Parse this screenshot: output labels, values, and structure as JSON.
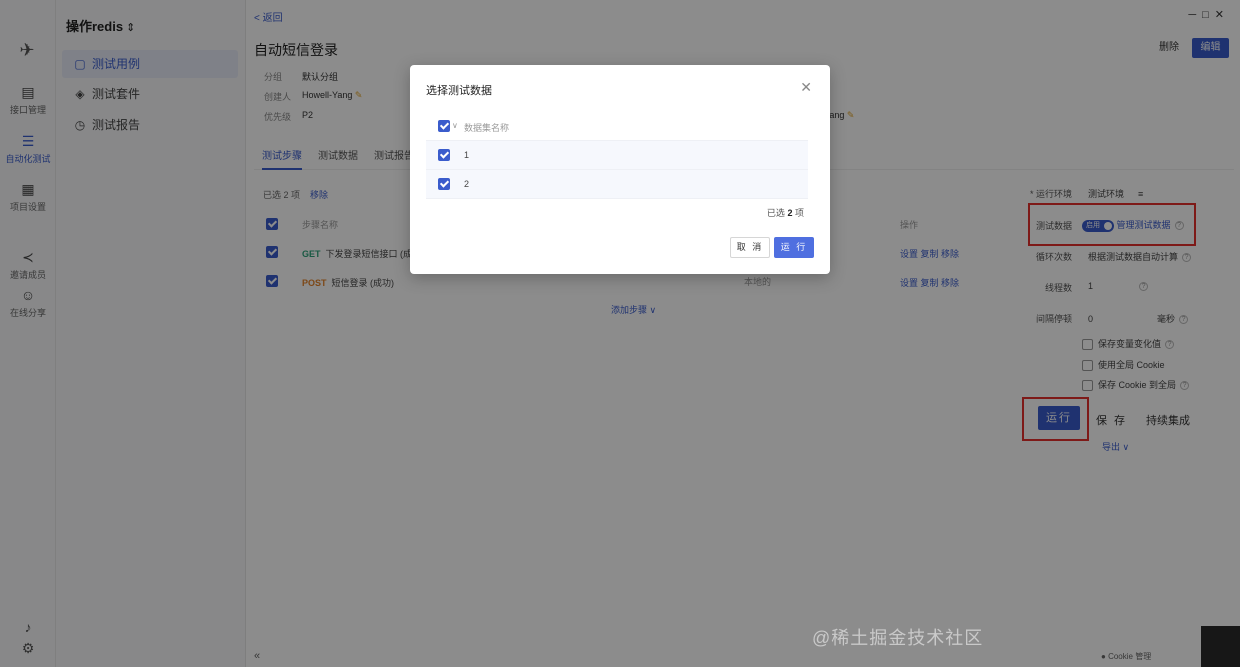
{
  "rail": {
    "items": [
      {
        "label": "接口管理"
      },
      {
        "label": "自动化测试"
      },
      {
        "label": "项目设置"
      },
      {
        "label": "邀请成员"
      },
      {
        "label": "在线分享"
      }
    ]
  },
  "subnav": {
    "title": "操作redis",
    "items": [
      {
        "label": "测试用例"
      },
      {
        "label": "测试套件"
      },
      {
        "label": "测试报告"
      }
    ]
  },
  "header": {
    "back": "< 返回",
    "title": "自动短信登录",
    "delete": "删除",
    "edit": "编辑"
  },
  "meta": {
    "group_label": "分组",
    "group_value": "默认分组",
    "creator_label": "创建人",
    "creator_value": "Howell-Yang",
    "priority_label": "优先级",
    "priority_value": "P2",
    "right_value": "Yang"
  },
  "tabs": [
    {
      "label": "测试步骤"
    },
    {
      "label": "测试数据"
    },
    {
      "label": "测试报告"
    }
  ],
  "steps": {
    "selected_text": "已选 2 项",
    "remove": "移除",
    "col_name": "步骤名称",
    "col_op": "操作",
    "rows": [
      {
        "method": "GET",
        "name": "下发登录短信接口 (成"
      },
      {
        "method": "POST",
        "name": "短信登录 (成功)"
      }
    ],
    "row_ops": "设置 复制 移除",
    "dim_col": "本地的",
    "add_step": "添加步骤 ∨"
  },
  "config": {
    "env_label": "* 运行环境",
    "env_value": "测试环境",
    "data_label": "测试数据",
    "data_toggle": "启用",
    "data_manage": "管理测试数据",
    "loop_label": "循环次数",
    "loop_value": "根据测试数据自动计算",
    "threads_label": "线程数",
    "threads_value": "1",
    "interval_label": "间隔停顿",
    "interval_value": "0",
    "interval_unit": "毫秒",
    "opt1": "保存变量变化值",
    "opt2": "使用全局 Cookie",
    "opt3": "保存 Cookie 到全局",
    "run": "运行",
    "save": "保 存",
    "ci": "持续集成",
    "export": "导出 ∨"
  },
  "footer": {
    "cookie": "Cookie 管理",
    "watermark": "@稀土掘金技术社区"
  },
  "modal": {
    "title": "选择测试数据",
    "col_header": "数据集名称",
    "rows": [
      {
        "name": "1"
      },
      {
        "name": "2"
      }
    ],
    "selected_prefix": "已选",
    "selected_count": "2",
    "selected_suffix": "项",
    "cancel": "取 消",
    "run": "运 行"
  }
}
